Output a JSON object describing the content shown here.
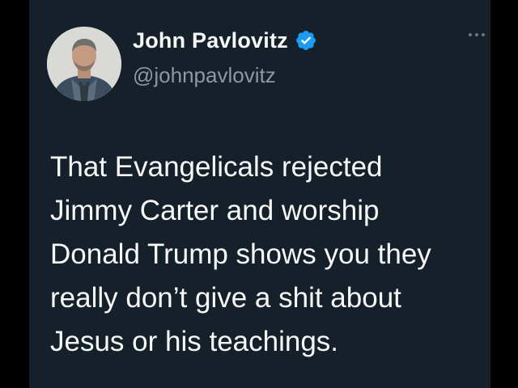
{
  "author": {
    "display_name": "John Pavlovitz",
    "handle": "@johnpavlovitz",
    "verified": true,
    "avatar": "profile-photo"
  },
  "tweet": {
    "lines": [
      "That Evangelicals rejected",
      "Jimmy Carter and worship",
      "Donald Trump shows you they",
      "really don’t give a shit about",
      "Jesus or his teachings."
    ]
  },
  "icons": {
    "verified": "verified-badge-icon",
    "more": "more-options-icon"
  },
  "colors": {
    "card_background": "#15202b",
    "text_primary": "#f7f9f9",
    "text_secondary": "#8b98a5",
    "verified_blue": "#1d9bf0"
  }
}
